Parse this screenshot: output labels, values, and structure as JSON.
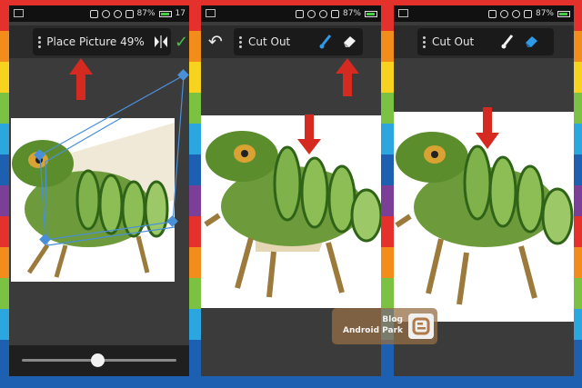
{
  "panels": [
    {
      "status_time": "17",
      "battery_text": "87%",
      "tool_label": "Place Picture 49%",
      "tool_icon": "flip-horizontal-icon",
      "slider_value": 0.49
    },
    {
      "battery_text": "87%",
      "tool_label": "Cut Out",
      "tool_icons": [
        "brush-icon",
        "eraser-icon"
      ]
    },
    {
      "status_time": "",
      "battery_text": "87%",
      "tool_label": "Cut Out",
      "tool_icons": [
        "brush-icon",
        "eraser-icon"
      ]
    }
  ],
  "watermark": {
    "line1": "Blog",
    "line2": "Android Park"
  },
  "colors": {
    "arrow": "#d42a1f",
    "check": "#4bc24b",
    "brush": "#2f9be6"
  }
}
